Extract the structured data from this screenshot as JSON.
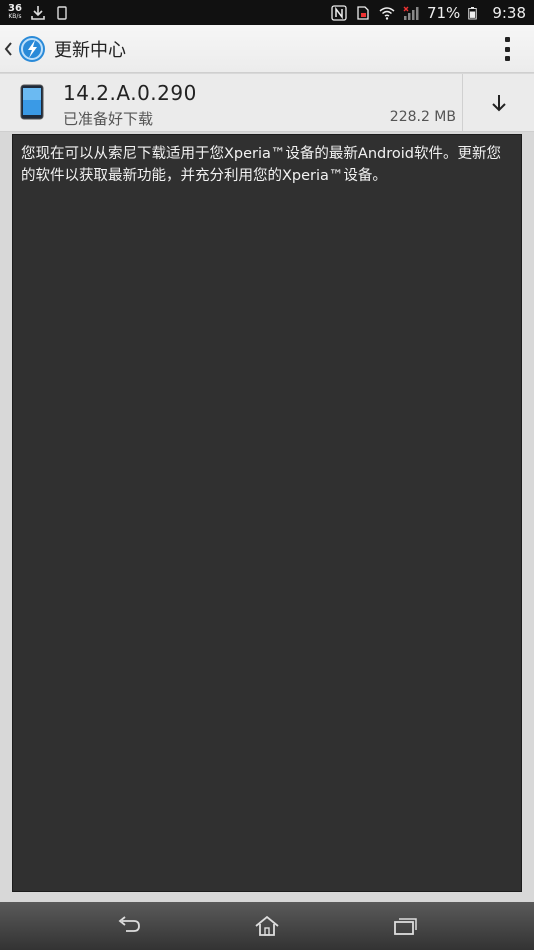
{
  "status_bar": {
    "net_speed_value": "36",
    "net_speed_unit": "KB/s",
    "battery_percent": "71%",
    "time": "9:38"
  },
  "app_bar": {
    "title": "更新中心"
  },
  "update": {
    "version": "14.2.A.0.290",
    "status": "已准备好下载",
    "size": "228.2 MB"
  },
  "content": {
    "description": "您现在可以从索尼下载适用于您Xperia™设备的最新Android软件。更新您的软件以获取最新功能，并充分利用您的Xperia™设备。"
  },
  "colors": {
    "content_bg": "#303030",
    "app_bar_bg": "#f2f2f2",
    "accent_blue": "#2a8ad8"
  }
}
